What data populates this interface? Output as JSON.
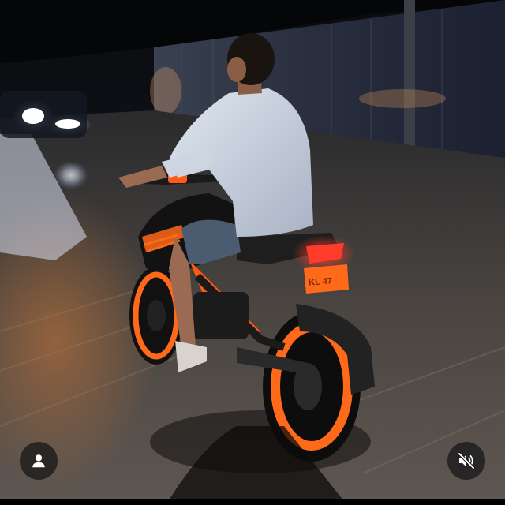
{
  "media": {
    "description_icon": "photo-scene",
    "plate_text": "KL 47"
  },
  "controls": {
    "profile_icon": "user-icon",
    "mute_icon": "speaker-muted-icon"
  },
  "colors": {
    "accent_orange": "#ff6a1a",
    "taillight_red": "#ff3b2a",
    "button_bg": "#141416",
    "icon_white": "#ffffff"
  }
}
